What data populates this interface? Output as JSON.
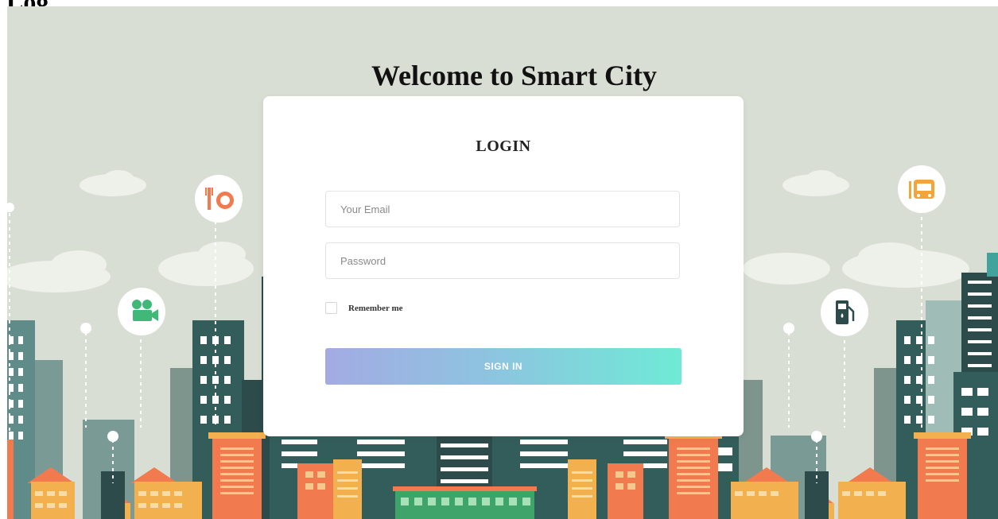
{
  "page": {
    "heading": "Log",
    "welcome": "Welcome to Smart City"
  },
  "login": {
    "title": "LOGIN",
    "email_placeholder": "Your Email",
    "password_placeholder": "Password",
    "remember_label": "Remember me",
    "signin_label": "SIGN IN"
  },
  "icons": [
    "restaurant-icon",
    "movie-camera-icon",
    "bus-icon",
    "fuel-pump-icon"
  ],
  "colors": {
    "background": "#d9ded5",
    "building_dark": "#335d5b",
    "building_mid": "#5f8c88",
    "building_orange": "#f17b4e",
    "building_yellow": "#f3b04f",
    "button_gradient_start": "#a3abe3",
    "button_gradient_end": "#6fead6"
  }
}
